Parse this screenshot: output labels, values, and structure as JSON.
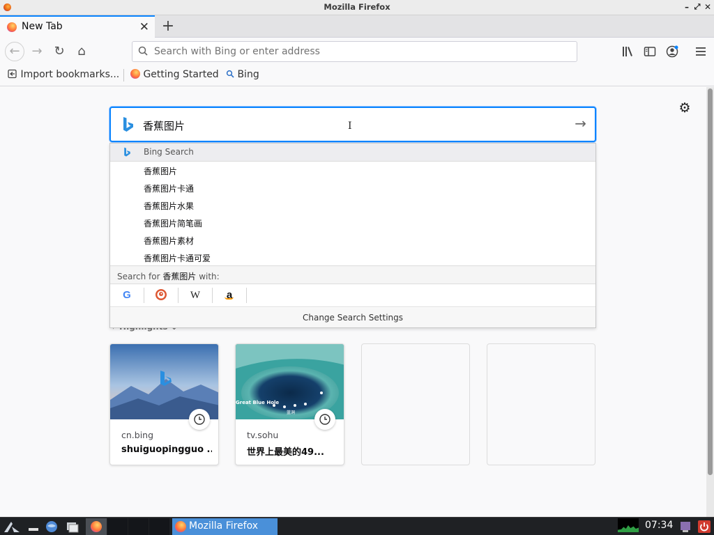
{
  "window": {
    "title": "Mozilla Firefox"
  },
  "tabs": [
    {
      "label": "New Tab",
      "active": true
    }
  ],
  "urlbar": {
    "placeholder": "Search with Bing or enter address"
  },
  "bookmarks": [
    {
      "label": "Import bookmarks...",
      "icon": "import-icon"
    },
    {
      "label": "Getting Started",
      "icon": "firefox-icon"
    },
    {
      "label": "Bing",
      "icon": "search-icon"
    }
  ],
  "search": {
    "query": "香蕉图片",
    "engine_header": "Bing Search",
    "suggestions": [
      "香蕉图片",
      "香蕉图片卡通",
      "香蕉图片水果",
      "香蕉图片简笔画",
      "香蕉图片素材",
      "香蕉图片卡通可爱"
    ],
    "search_for_prefix": "Search for ",
    "search_for_query": "香蕉图片",
    "search_for_suffix": " with:",
    "engines": [
      "google-icon",
      "duckduckgo-icon",
      "wikipedia-icon",
      "amazon-icon"
    ],
    "change_settings": "Change Search Settings"
  },
  "highlights": {
    "heading": "Highlights",
    "cards": [
      {
        "host": "cn.bing",
        "title": "shuiguopingguo ..."
      },
      {
        "host": "tv.sohu",
        "title": "世界上最美的49...",
        "thumb_caption": "Great Blue Hole",
        "thumb_caption_2": "蓝洞"
      }
    ]
  },
  "taskbar": {
    "task_label": "Mozilla Firefox",
    "clock": "07:34"
  },
  "colors": {
    "accent": "#0a84ff",
    "taskbar": "#1f2124",
    "task_active": "#4a90d9"
  }
}
